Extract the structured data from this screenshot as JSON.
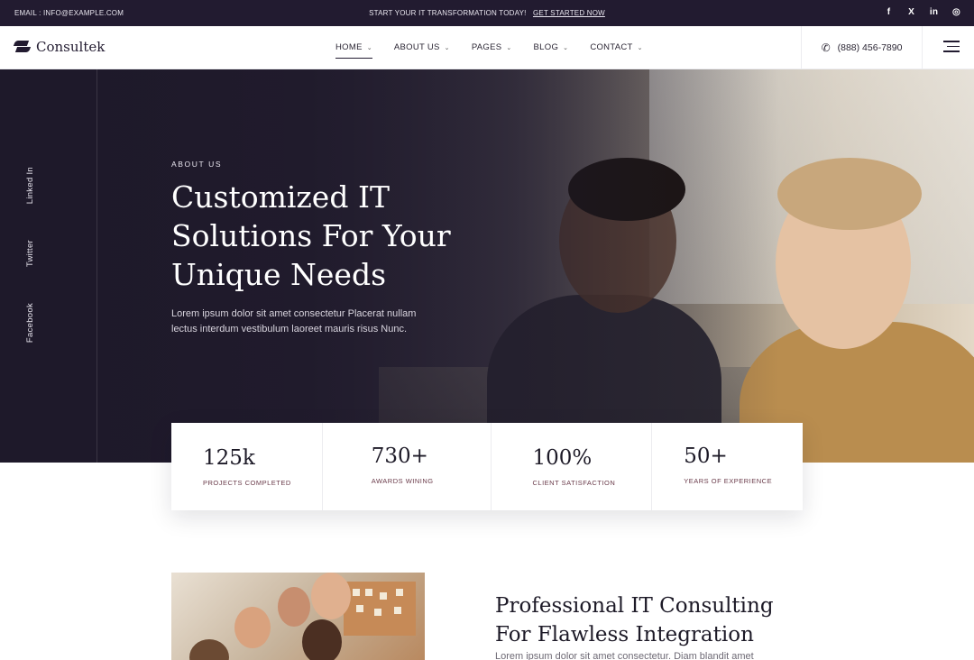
{
  "topbar": {
    "email": "EMAIL : INFO@EXAMPLE.COM",
    "promo_text": "START YOUR IT TRANSFORMATION TODAY!",
    "promo_cta": "GET STARTED NOW",
    "socials": [
      "f",
      "X",
      "in",
      "◎"
    ]
  },
  "nav": {
    "logo_text": "Consultek",
    "items": [
      {
        "label": "HOME"
      },
      {
        "label": "ABOUT US"
      },
      {
        "label": "PAGES"
      },
      {
        "label": "BLOG"
      },
      {
        "label": "CONTACT"
      }
    ],
    "phone": "(888) 456-7890"
  },
  "hero": {
    "side_links": [
      "Linked In",
      "Twitter",
      "Facebook"
    ],
    "eyebrow": "ABOUT US",
    "title": "Customized IT Solutions For Your Unique Needs",
    "text": "Lorem ipsum dolor sit amet consectetur Placerat nullam lectus interdum vestibulum laoreet mauris risus Nunc."
  },
  "stats": [
    {
      "value": "125k",
      "label": "PROJECTS COMPLETED"
    },
    {
      "value": "730+",
      "label": "AWARDS WINING"
    },
    {
      "value": "100%",
      "label": "CLIENT SATISFACTION"
    },
    {
      "value": "50+",
      "label": "YEARS OF EXPERIENCE"
    }
  ],
  "about": {
    "title": "Professional IT Consulting For Flawless Integration",
    "text": "Lorem ipsum dolor sit amet consectetur. Diam blandit amet"
  },
  "colors": {
    "dark": "#221b30",
    "accent_label": "#6a3b4a",
    "white": "#ffffff"
  }
}
